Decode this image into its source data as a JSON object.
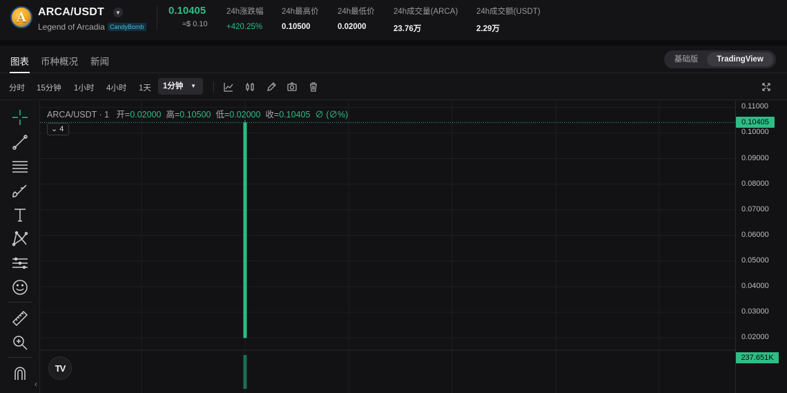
{
  "ticker": {
    "coin_glyph": "A",
    "pair": "ARCA/USDT",
    "project_name": "Legend of Arcadia",
    "tag": "CandyBomb",
    "last_price": "0.10405",
    "last_price_usd": "≈$ 0.10",
    "stats": [
      {
        "label": "24h涨跌幅",
        "value": "+420.25%"
      },
      {
        "label": "24h最高价",
        "value": "0.10500"
      },
      {
        "label": "24h最低价",
        "value": "0.02000"
      },
      {
        "label": "24h成交量(ARCA)",
        "value": "23.76万"
      },
      {
        "label": "24h成交额(USDT)",
        "value": "2.29万"
      }
    ],
    "colors": {
      "up": "#2ebd85"
    }
  },
  "tabs": {
    "items": [
      "图表",
      "币种概况",
      "新闻"
    ],
    "active": "图表",
    "view_modes": [
      "基础版",
      "TradingView"
    ],
    "active_mode": "TradingView"
  },
  "toolbar": {
    "timeframes": [
      "分时",
      "15分钟",
      "1小时",
      "4小时",
      "1天"
    ],
    "active_timeframe": "1分钟",
    "icons": [
      "indicator-icon",
      "candle-style-icon",
      "pencil-icon",
      "camera-icon",
      "trash-icon",
      "fullscreen-icon"
    ]
  },
  "drawing_tools": [
    "crosshair-icon",
    "trend-line-icon",
    "horizontal-lines-icon",
    "brush-icon",
    "text-icon",
    "pattern-icon",
    "measure-lines-icon",
    "emoji-icon",
    "ruler-icon",
    "zoom-in-icon",
    "magnet-icon"
  ],
  "chart": {
    "symbol": "ARCA/USDT",
    "interval": "1",
    "open_label": "开",
    "open": "0.02000",
    "high_label": "高",
    "high": "0.10500",
    "low_label": "低",
    "low": "0.02000",
    "close_label": "收",
    "close": "0.10405",
    "change": "∅ (∅%)",
    "indicator_count": "4",
    "watermark": "TV",
    "last_price_label": "0.10405",
    "volume_label": "237.651K"
  },
  "chart_data": {
    "type": "candlestick",
    "symbol": "ARCA/USDT",
    "interval": "1",
    "candles": [
      {
        "open": 0.02,
        "high": 0.105,
        "low": 0.02,
        "close": 0.10405,
        "volume": 237651
      }
    ],
    "y_ticks": [
      "0.11000",
      "0.10000",
      "0.09000",
      "0.08000",
      "0.07000",
      "0.06000",
      "0.05000",
      "0.04000",
      "0.03000",
      "0.02000"
    ],
    "ylim": [
      0.0155,
      0.1125
    ],
    "last_price": 0.10405,
    "grid": true,
    "colors": {
      "up": "#2ebd85",
      "volume": "#1f6e51"
    }
  }
}
